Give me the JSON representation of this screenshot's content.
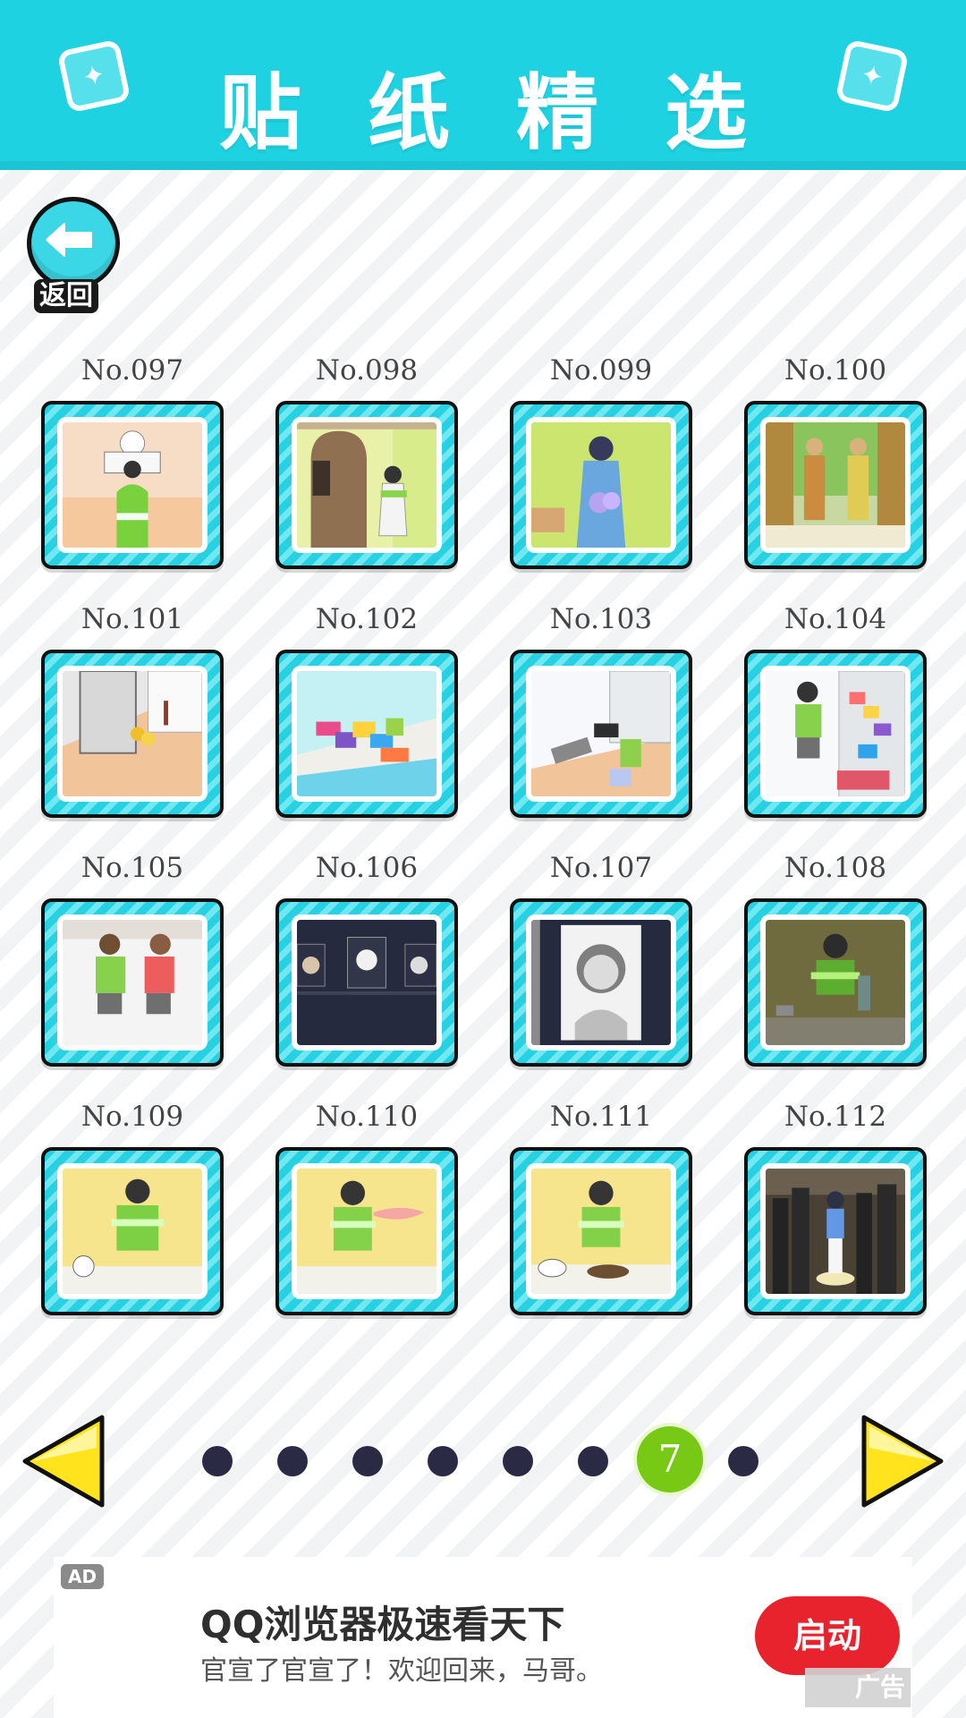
{
  "header": {
    "title": "贴纸精选",
    "badge_icon": "sticker-star-icon",
    "accent_color": "#1fd2e2"
  },
  "back_button": {
    "label": "返回",
    "icon": "back-arrow-icon"
  },
  "stickers": [
    {
      "label": "No.097",
      "scene": "old-man-holding-paper"
    },
    {
      "label": "No.098",
      "scene": "doorway-boy"
    },
    {
      "label": "No.099",
      "scene": "girl-with-flowers"
    },
    {
      "label": "No.100",
      "scene": "two-monks"
    },
    {
      "label": "No.101",
      "scene": "cabinet-floor"
    },
    {
      "label": "No.102",
      "scene": "pile-of-gifts"
    },
    {
      "label": "No.103",
      "scene": "lockers-falling"
    },
    {
      "label": "No.104",
      "scene": "boy-with-gifts"
    },
    {
      "label": "No.105",
      "scene": "two-boys-walking"
    },
    {
      "label": "No.106",
      "scene": "dark-portraits"
    },
    {
      "label": "No.107",
      "scene": "boy-portrait"
    },
    {
      "label": "No.108",
      "scene": "boy-seated-dark"
    },
    {
      "label": "No.109",
      "scene": "boy-back-yellow"
    },
    {
      "label": "No.110",
      "scene": "boy-drinking"
    },
    {
      "label": "No.111",
      "scene": "boy-eating"
    },
    {
      "label": "No.112",
      "scene": "girl-in-crowd"
    }
  ],
  "pagination": {
    "total_dots": 8,
    "current_page": "7",
    "active_index": 6,
    "active_color": "#78c916",
    "prev_icon": "previous-page-arrow-icon",
    "next_icon": "next-page-arrow-icon"
  },
  "ad": {
    "tag": "AD",
    "title": "QQ浏览器极速看天下",
    "subtitle": "官宣了官宣了！欢迎回来，马哥。",
    "cta": "启动",
    "source": "广告",
    "cta_color": "#e8232e"
  }
}
